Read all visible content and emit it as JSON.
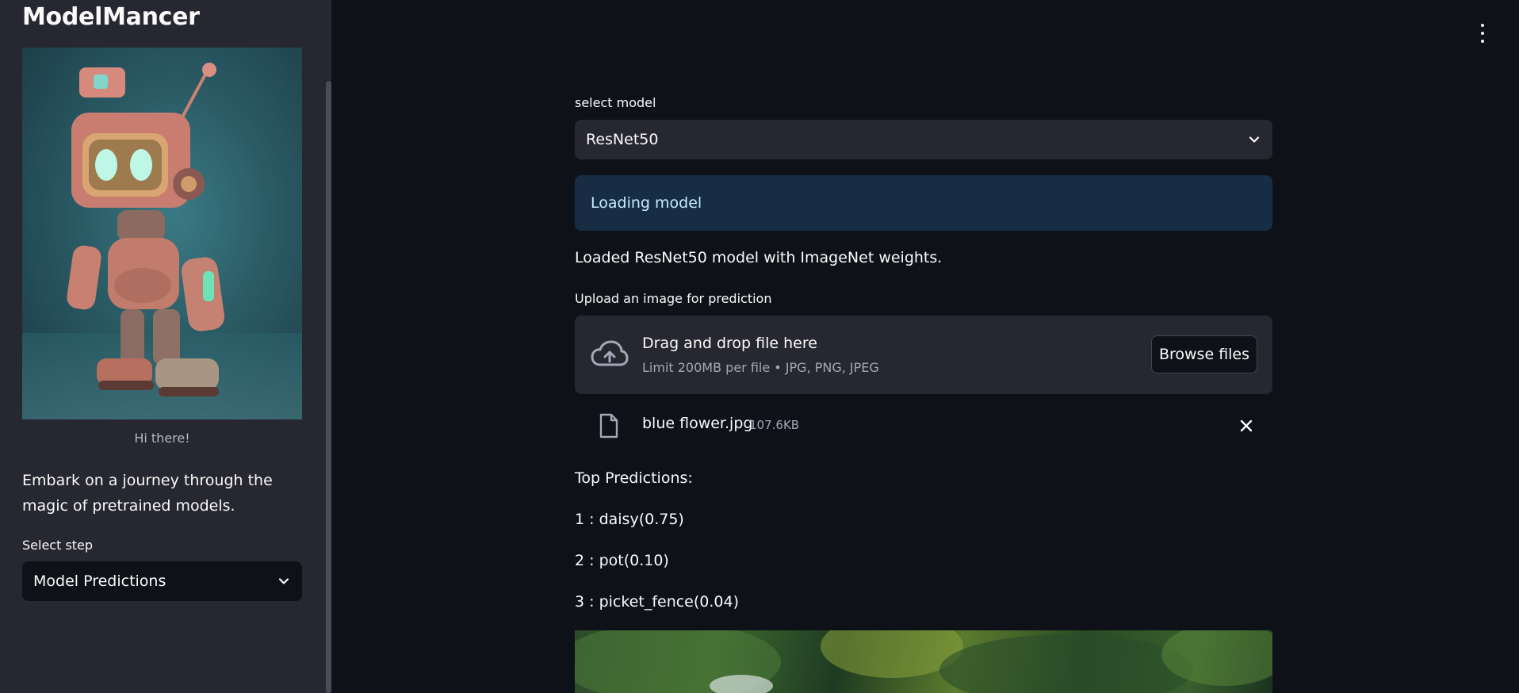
{
  "sidebar": {
    "app_title": "ModelMancer",
    "image_caption": "Hi there!",
    "description": "Embark on a journey through the magic of pretrained models.",
    "select_step_label": "Select step",
    "select_step_value": "Model Predictions"
  },
  "main": {
    "select_model_label": "select model",
    "select_model_value": "ResNet50",
    "info_message": "Loading model",
    "loaded_message": "Loaded ResNet50 model with ImageNet weights.",
    "upload": {
      "label": "Upload an image for prediction",
      "drop_title": "Drag and drop file here",
      "drop_subtitle": "Limit 200MB per file • JPG, PNG, JPEG",
      "browse_label": "Browse files"
    },
    "file": {
      "name": "blue flower.jpg",
      "size": "107.6KB"
    },
    "predictions": {
      "title": "Top Predictions:",
      "items": [
        "1 : daisy(0.75)",
        "2 : pot(0.10)",
        "3 : picket_fence(0.04)"
      ]
    }
  },
  "icons": {
    "menu": "vertical-dots-icon",
    "upload": "cloud-upload-icon",
    "file": "file-icon",
    "remove": "close-icon",
    "dropdown": "chevron-down-icon"
  },
  "colors": {
    "background": "#0e1117",
    "sidebar": "#262730",
    "info_bg": "#172d43",
    "info_text": "#c7ebff"
  }
}
